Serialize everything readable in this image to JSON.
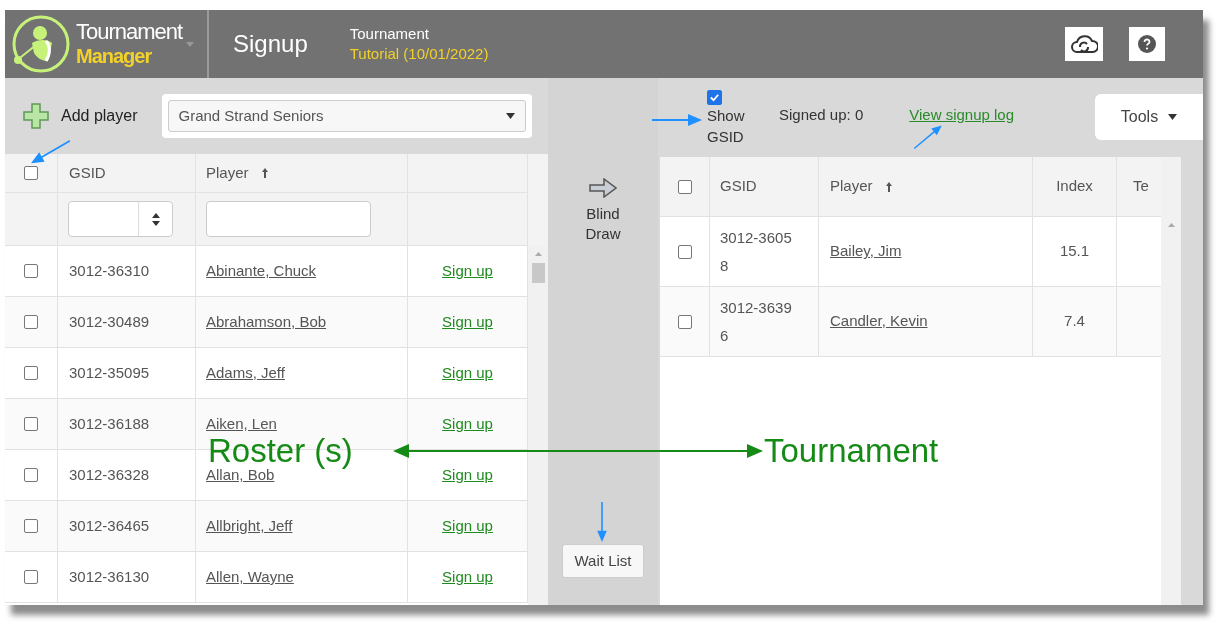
{
  "header": {
    "logo_top": "Tournament",
    "logo_bottom": "Manager",
    "page_title": "Signup",
    "event_label": "Tournament",
    "event_name": "Tutorial (10/01/2022)"
  },
  "roster_toolbar": {
    "add_button": "Add player",
    "roster_select": "Grand Strand Seniors"
  },
  "roster_table": {
    "header_checked": false,
    "columns": [
      "GSID",
      "Player"
    ],
    "rows": [
      {
        "gsid": "3012-36310",
        "player": "Abinante, Chuck",
        "action": "Sign up",
        "checked": false
      },
      {
        "gsid": "3012-30489",
        "player": "Abrahamson, Bob",
        "action": "Sign up",
        "checked": false
      },
      {
        "gsid": "3012-35095",
        "player": "Adams, Jeff",
        "action": "Sign up",
        "checked": false
      },
      {
        "gsid": "3012-36188",
        "player": "Aiken, Len",
        "action": "Sign up",
        "checked": false
      },
      {
        "gsid": "3012-36328",
        "player": "Allan, Bob",
        "action": "Sign up",
        "checked": false
      },
      {
        "gsid": "3012-36465",
        "player": "Allbright, Jeff",
        "action": "Sign up",
        "checked": false
      },
      {
        "gsid": "3012-36130",
        "player": "Allen, Wayne",
        "action": "Sign up",
        "checked": false
      }
    ]
  },
  "middle": {
    "blind_draw": "Blind Draw",
    "wait_list": "Wait List"
  },
  "tournament_toolbar": {
    "show_gsid_label": "Show GSID",
    "show_gsid_checked": true,
    "signed_up": "Signed up: 0",
    "log_link": "View signup log",
    "tools_button": "Tools"
  },
  "tournament_table": {
    "header_checked": false,
    "columns": [
      "GSID",
      "Player",
      "Index",
      "Te"
    ],
    "rows": [
      {
        "gsid": "3012-36058",
        "player": "Bailey, Jim",
        "index": "15.1",
        "checked": false
      },
      {
        "gsid": "3012-36396",
        "player": "Candler, Kevin",
        "index": "7.4",
        "checked": false
      }
    ]
  },
  "annotations": {
    "left_label": "Roster (s)",
    "right_label": "Tournament"
  }
}
